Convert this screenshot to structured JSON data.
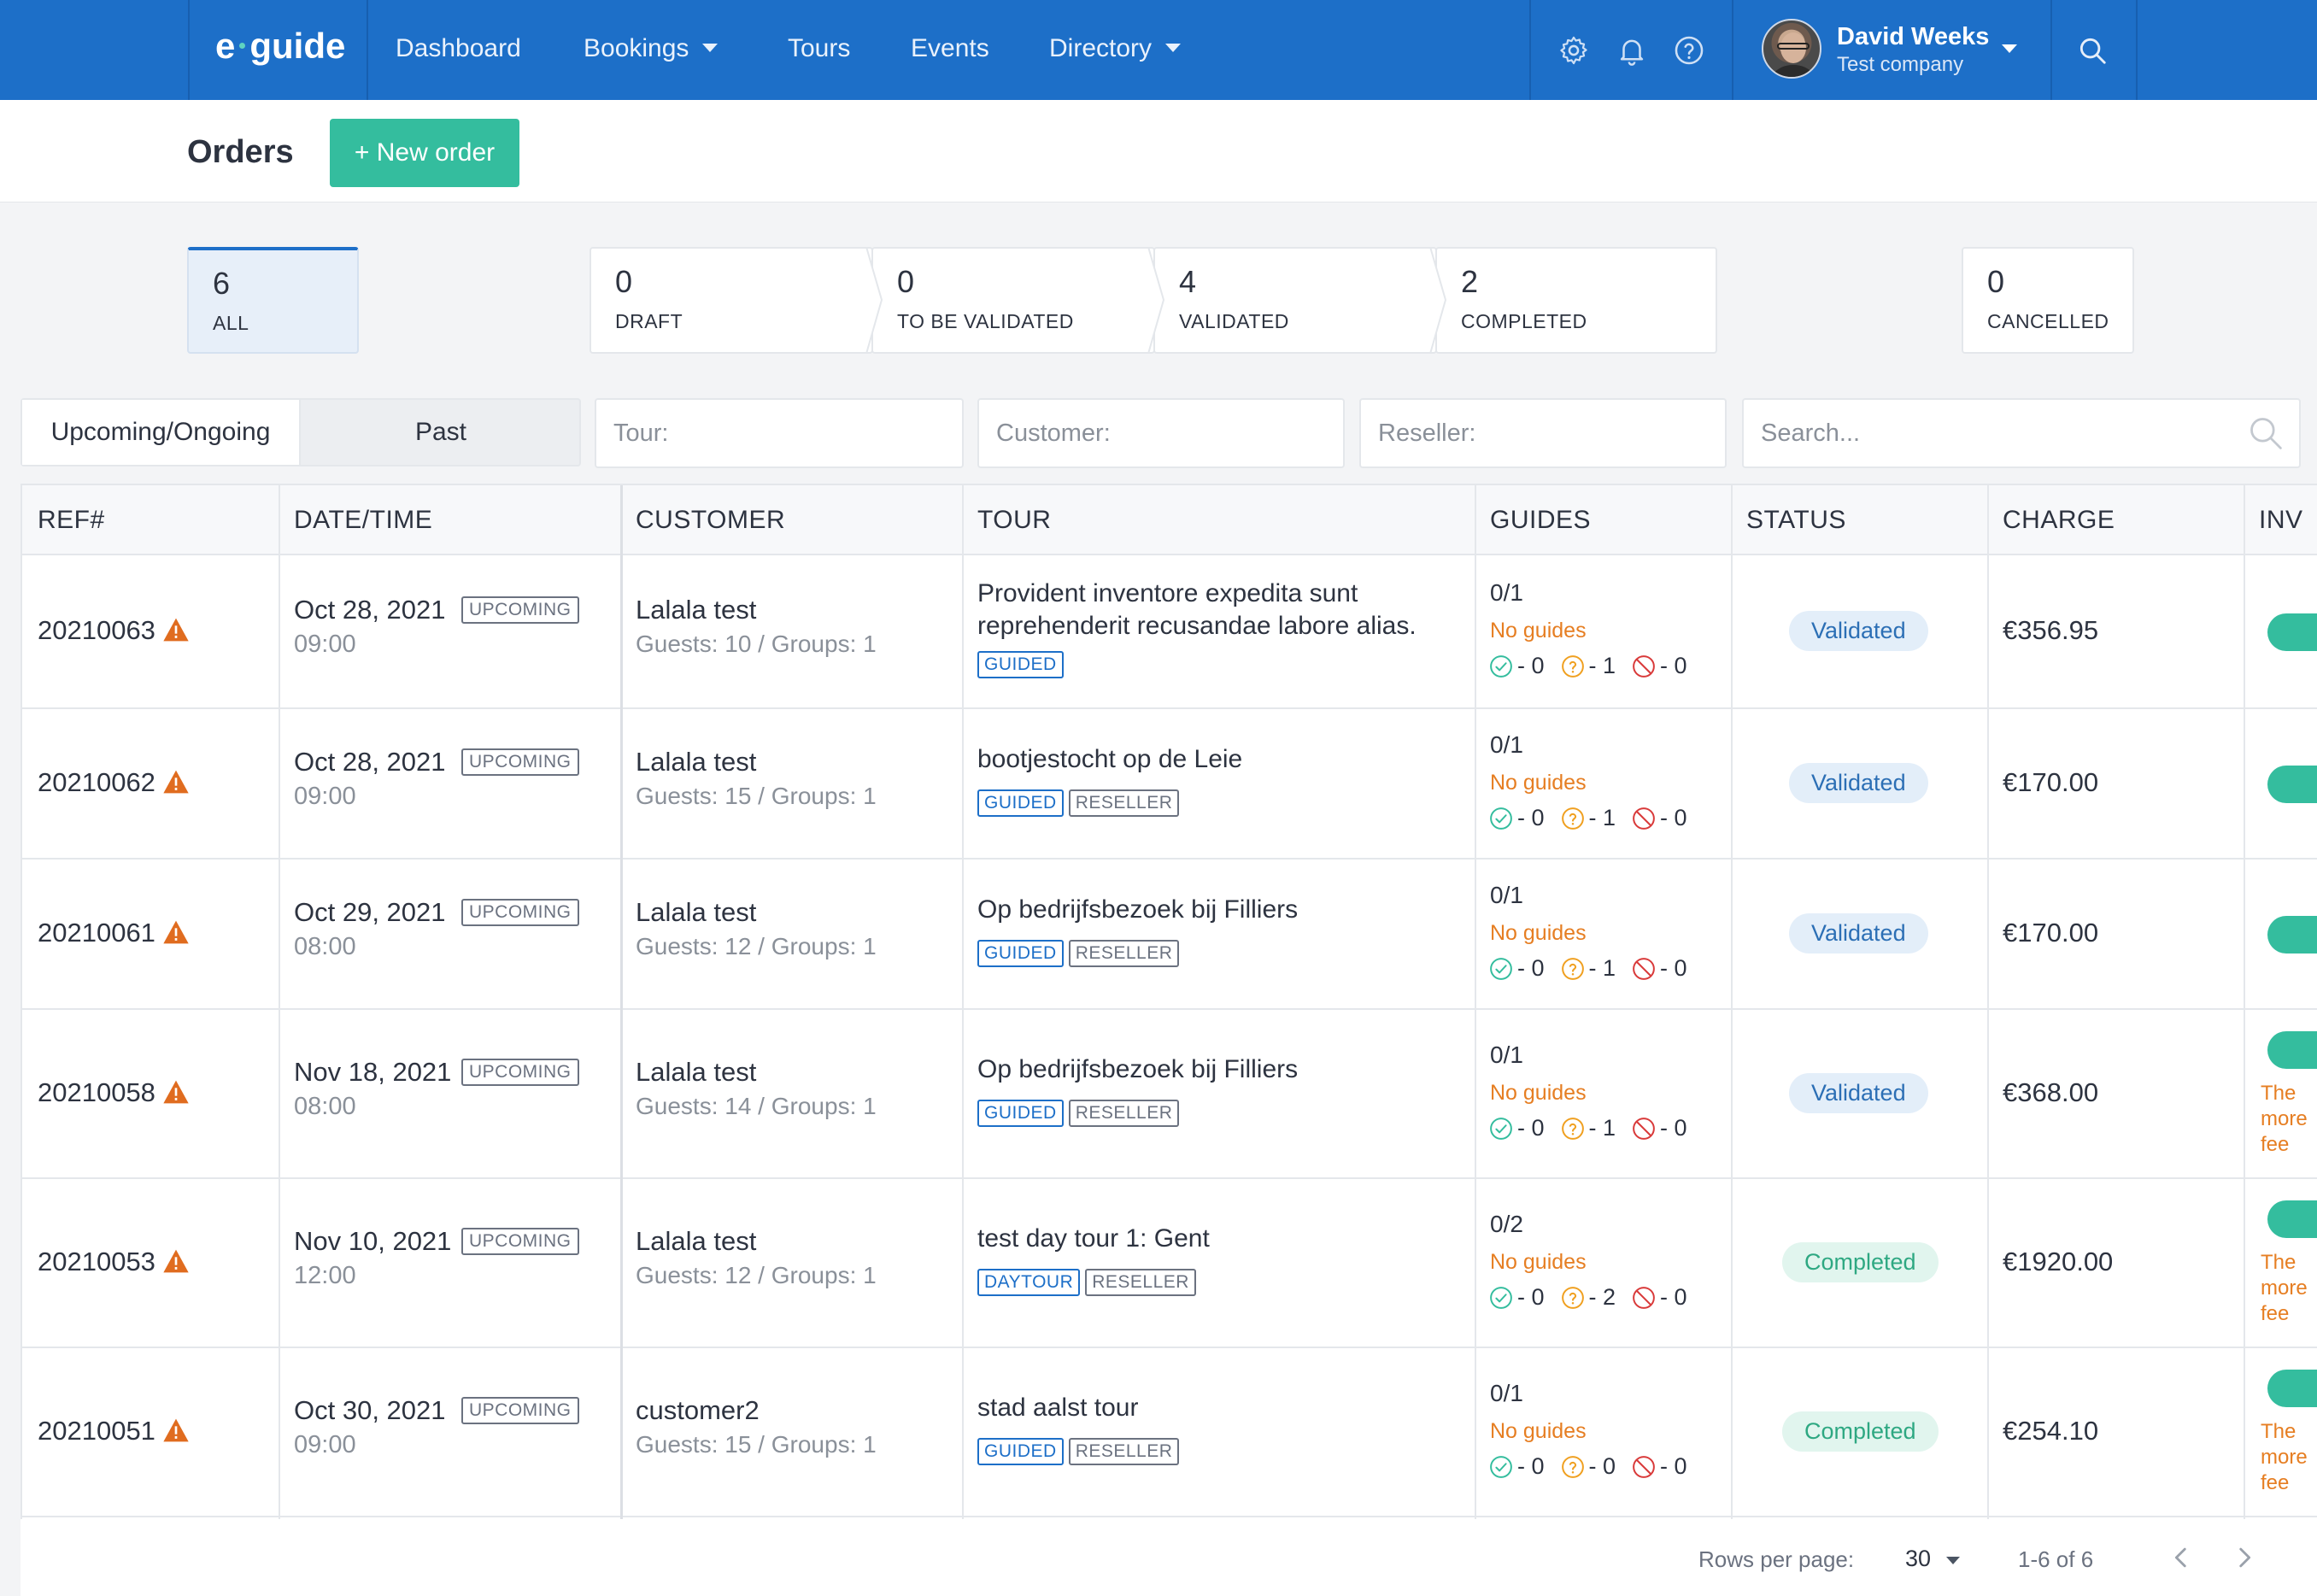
{
  "nav": {
    "logo_left": "e",
    "logo_right": "guide",
    "links": [
      {
        "label": "Dashboard",
        "dropdown": false
      },
      {
        "label": "Bookings",
        "dropdown": true
      },
      {
        "label": "Tours",
        "dropdown": false
      },
      {
        "label": "Events",
        "dropdown": false
      },
      {
        "label": "Directory",
        "dropdown": true
      }
    ],
    "icons": [
      "gear-icon",
      "bell-icon",
      "help-icon",
      "search-icon"
    ],
    "user": {
      "name": "David Weeks",
      "company": "Test company"
    }
  },
  "header": {
    "title": "Orders",
    "new_button": "+ New order"
  },
  "status_cards": [
    {
      "count": "6",
      "label": "ALL",
      "active": true
    },
    {
      "count": "0",
      "label": "DRAFT",
      "active": false
    },
    {
      "count": "0",
      "label": "TO BE VALIDATED",
      "active": false
    },
    {
      "count": "4",
      "label": "VALIDATED",
      "active": false
    },
    {
      "count": "2",
      "label": "COMPLETED",
      "active": false
    },
    {
      "count": "0",
      "label": "CANCELLED",
      "active": false
    }
  ],
  "filters": {
    "time_tabs": [
      {
        "label": "Upcoming/Ongoing",
        "selected": true
      },
      {
        "label": "Past",
        "selected": false
      }
    ],
    "tour_placeholder": "Tour:",
    "customer_placeholder": "Customer:",
    "reseller_placeholder": "Reseller:",
    "search_placeholder": "Search..."
  },
  "table": {
    "columns": [
      "REF#",
      "DATE/TIME",
      "CUSTOMER",
      "TOUR",
      "GUIDES",
      "STATUS",
      "CHARGE",
      "INV"
    ],
    "rows": [
      {
        "ref": "20210063",
        "date": "Oct 28, 2021",
        "time": "09:00",
        "badge": "UPCOMING",
        "customer": "Lalala test",
        "guests": "Guests: 10 / Groups: 1",
        "tour": "Provident inventore expedita sunt reprehenderit recusandae labore alias.",
        "tags": [
          "GUIDED"
        ],
        "guides": "0/1",
        "no_guides": "No guides",
        "ok": "- 0",
        "pending": "- 1",
        "declined": "- 0",
        "status": "Validated",
        "charge": "€356.95",
        "inv_note": [
          "",
          "",
          ""
        ]
      },
      {
        "ref": "20210062",
        "date": "Oct 28, 2021",
        "time": "09:00",
        "badge": "UPCOMING",
        "customer": "Lalala test",
        "guests": "Guests: 15 / Groups: 1",
        "tour": "bootjestocht op de Leie",
        "tags": [
          "GUIDED",
          "RESELLER"
        ],
        "guides": "0/1",
        "no_guides": "No guides",
        "ok": "- 0",
        "pending": "- 1",
        "declined": "- 0",
        "status": "Validated",
        "charge": "€170.00",
        "inv_note": [
          "",
          "",
          ""
        ]
      },
      {
        "ref": "20210061",
        "date": "Oct 29, 2021",
        "time": "08:00",
        "badge": "UPCOMING",
        "customer": "Lalala test",
        "guests": "Guests: 12 / Groups: 1",
        "tour": "Op bedrijfsbezoek bij Filliers",
        "tags": [
          "GUIDED",
          "RESELLER"
        ],
        "guides": "0/1",
        "no_guides": "No guides",
        "ok": "- 0",
        "pending": "- 1",
        "declined": "- 0",
        "status": "Validated",
        "charge": "€170.00",
        "inv_note": [
          "",
          "",
          ""
        ]
      },
      {
        "ref": "20210058",
        "date": "Nov 18, 2021",
        "time": "08:00",
        "badge": "UPCOMING",
        "customer": "Lalala test",
        "guests": "Guests: 14 / Groups: 1",
        "tour": "Op bedrijfsbezoek bij Filliers",
        "tags": [
          "GUIDED",
          "RESELLER"
        ],
        "guides": "0/1",
        "no_guides": "No guides",
        "ok": "- 0",
        "pending": "- 1",
        "declined": "- 0",
        "status": "Validated",
        "charge": "€368.00",
        "inv_note": [
          "The",
          "more",
          "fee"
        ]
      },
      {
        "ref": "20210053",
        "date": "Nov 10, 2021",
        "time": "12:00",
        "badge": "UPCOMING",
        "customer": "Lalala test",
        "guests": "Guests: 12 / Groups: 1",
        "tour": "test day tour 1: Gent",
        "tags": [
          "DAYTOUR",
          "RESELLER"
        ],
        "guides": "0/2",
        "no_guides": "No guides",
        "ok": "- 0",
        "pending": "- 2",
        "declined": "- 0",
        "status": "Completed",
        "charge": "€1920.00",
        "inv_note": [
          "The",
          "more",
          "fee"
        ]
      },
      {
        "ref": "20210051",
        "date": "Oct 30, 2021",
        "time": "09:00",
        "badge": "UPCOMING",
        "customer": "customer2",
        "guests": "Guests: 15 / Groups: 1",
        "tour": "stad aalst tour",
        "tags": [
          "GUIDED",
          "RESELLER"
        ],
        "guides": "0/1",
        "no_guides": "No guides",
        "ok": "- 0",
        "pending": "- 0",
        "declined": "- 0",
        "status": "Completed",
        "charge": "€254.10",
        "inv_note": [
          "The",
          "more",
          "fee"
        ]
      }
    ]
  },
  "footer": {
    "rows_per_page_label": "Rows per page:",
    "rows_per_page": "30",
    "range": "1-6 of 6"
  },
  "colors": {
    "primary": "#1d6fc8",
    "accent": "#34bd9e",
    "warning": "#e67e22",
    "danger": "#d93a3a"
  }
}
